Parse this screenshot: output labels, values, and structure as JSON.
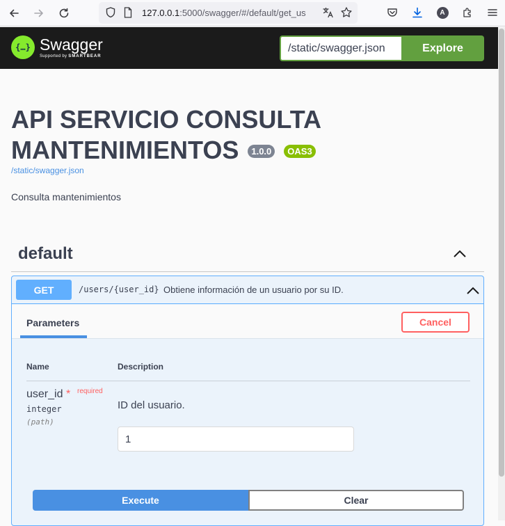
{
  "browser": {
    "url_host": "127.0.0.1",
    "url_rest": ":5000/swagger/#/default/get_us"
  },
  "topbar": {
    "logo_word": "Swagger",
    "logo_sub_prefix": "Supported by",
    "logo_sub_brand": "SMARTBEAR",
    "logo_glyph": "{…}",
    "explore_value": "/static/swagger.json",
    "explore_label": "Explore"
  },
  "info": {
    "title": "API SERVICIO CONSULTA MANTENIMIENTOS",
    "version": "1.0.0",
    "oas": "OAS3",
    "spec_link": "/static/swagger.json",
    "description": "Consulta mantenimientos"
  },
  "tag": {
    "name": "default"
  },
  "operation": {
    "method": "GET",
    "path": "/users/{user_id}",
    "summary": "Obtiene información de un usuario por su ID.",
    "params_tab": "Parameters",
    "cancel_label": "Cancel",
    "col_name": "Name",
    "col_description": "Description",
    "param": {
      "name": "user_id",
      "star": "*",
      "required": "required",
      "type": "integer",
      "in": "(path)",
      "description": "ID del usuario.",
      "value": "1"
    },
    "execute_label": "Execute",
    "clear_label": "Clear"
  },
  "colors": {
    "get": "#61affe",
    "oas": "#89bf04",
    "explore": "#62a03f",
    "cancel": "#ff6060",
    "execute": "#4990e2"
  }
}
